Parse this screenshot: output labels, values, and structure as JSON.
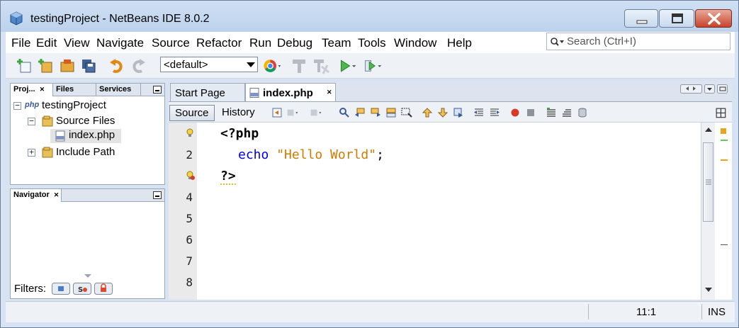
{
  "window": {
    "title": "testingProject - NetBeans IDE 8.0.2"
  },
  "menubar": {
    "items": [
      "File",
      "Edit",
      "View",
      "Navigate",
      "Source",
      "Refactor",
      "Run",
      "Debug",
      "Team",
      "Tools",
      "Window",
      "Help"
    ]
  },
  "search": {
    "placeholder": "Search (Ctrl+I)"
  },
  "toolbar": {
    "config_value": "<default>",
    "icons": [
      "new-project-icon",
      "new-file-icon",
      "open-project-icon",
      "save-all-icon",
      "undo-icon",
      "redo-icon",
      "chrome-browser-icon",
      "build-icon",
      "clean-build-icon",
      "run-icon",
      "debug-icon"
    ]
  },
  "projects_panel": {
    "tabs": [
      "Proj...",
      "Files",
      "Services"
    ],
    "tree": {
      "project": "testingProject",
      "project_badge": "php",
      "source_files": "Source Files",
      "file": "index.php",
      "include_path": "Include Path"
    }
  },
  "navigator_panel": {
    "title": "Navigator",
    "filters_label": "Filters:"
  },
  "editor": {
    "tabs": [
      "Start Page",
      "index.php"
    ],
    "active_tab": "index.php",
    "view_buttons": [
      "Source",
      "History"
    ],
    "active_view": "Source",
    "line_numbers": [
      "",
      "2",
      "",
      "4",
      "5",
      "6",
      "7",
      "8"
    ],
    "code": {
      "line1": "<?php",
      "line2_keyword": "echo",
      "line2_string": "\"Hello World\"",
      "line2_end": ";",
      "line3": "?>"
    }
  },
  "statusbar": {
    "position": "11:1",
    "mode": "INS"
  }
}
